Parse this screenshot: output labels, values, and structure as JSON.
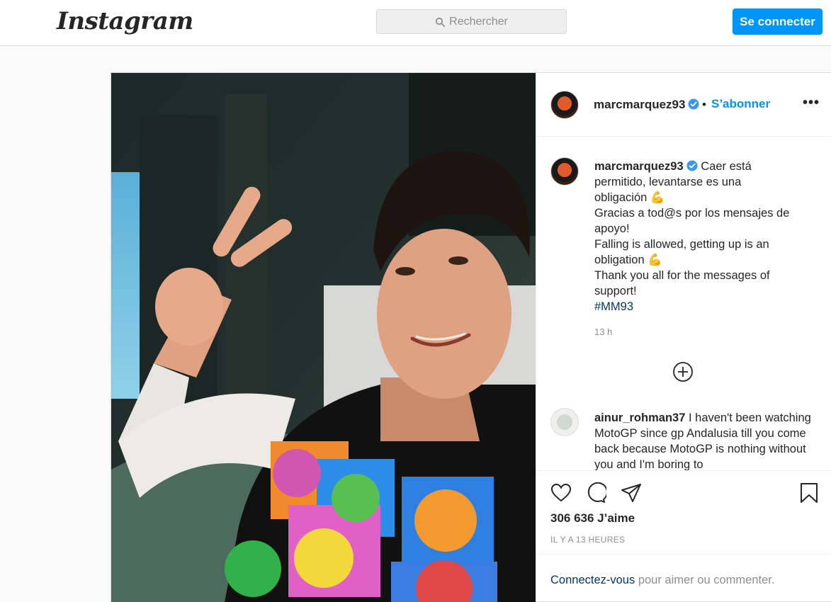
{
  "header": {
    "logo_text": "Instagram",
    "search_placeholder": "Rechercher",
    "login_button": "Se connecter"
  },
  "post": {
    "author": {
      "username": "marcmarquez93",
      "verified": true,
      "separator": "•",
      "follow_label": "S’abonner"
    },
    "more_label": "•••",
    "caption": {
      "username": "marcmarquez93",
      "lines": [
        "Caer está",
        "permitido, levantarse es una",
        "obligación 💪",
        "Gracias a tod@s por los mensajes de",
        "apoyo!",
        "Falling is allowed, getting up is an",
        "obligation 💪",
        "Thank you all for the messages of",
        "support!"
      ],
      "hashtag": "#MM93",
      "time": "13 h"
    },
    "first_comment": {
      "username": "ainur_rohman37",
      "text": "I haven't been watching MotoGP since gp Andalusia till you come back because MotoGP is nothing without you and I'm boring to"
    },
    "likes_text": "306 636 J’aime",
    "time_ago": "IL Y A 13 HEURES",
    "login_prompt": {
      "link": "Connectez-vous",
      "rest": " pour aimer ou commenter."
    }
  },
  "colors": {
    "accent": "#0095f6",
    "hashtag": "#00376b",
    "muted": "#8e8e8e",
    "border": "#dbdbdb"
  },
  "icons": [
    "search-icon",
    "verified-badge-icon",
    "more-options-icon",
    "load-more-comments-icon",
    "heart-icon",
    "comment-icon",
    "share-icon",
    "bookmark-icon"
  ]
}
